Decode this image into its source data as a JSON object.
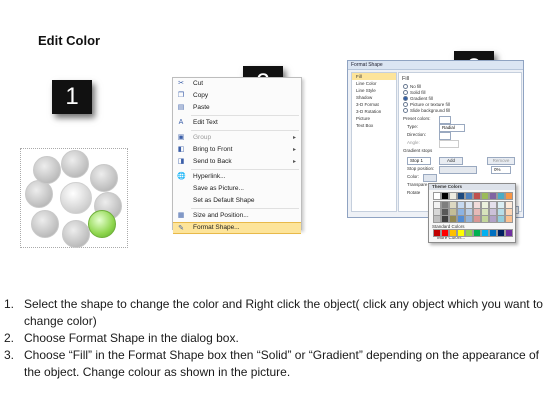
{
  "title": "Edit Color",
  "badges": [
    "1",
    "2",
    "3"
  ],
  "context_menu": {
    "items": [
      {
        "label": "Cut",
        "icon": "scissors-icon",
        "glyph": "✂",
        "disabled": false,
        "submenu": false
      },
      {
        "label": "Copy",
        "icon": "copy-icon",
        "glyph": "❐",
        "disabled": false,
        "submenu": false
      },
      {
        "label": "Paste",
        "icon": "paste-icon",
        "glyph": "▤",
        "disabled": false,
        "submenu": false
      },
      {
        "label": "Edit Text",
        "icon": "edit-text-icon",
        "glyph": "A",
        "disabled": false,
        "submenu": false
      },
      {
        "label": "Group",
        "icon": "group-icon",
        "glyph": "▣",
        "disabled": true,
        "submenu": true
      },
      {
        "label": "Bring to Front",
        "icon": "bring-front-icon",
        "glyph": "◧",
        "disabled": false,
        "submenu": true
      },
      {
        "label": "Send to Back",
        "icon": "send-back-icon",
        "glyph": "◨",
        "disabled": false,
        "submenu": true
      },
      {
        "label": "Hyperlink...",
        "icon": "hyperlink-icon",
        "glyph": "🌐",
        "disabled": false,
        "submenu": false
      },
      {
        "label": "Save as Picture...",
        "icon": "",
        "glyph": "",
        "disabled": false,
        "submenu": false
      },
      {
        "label": "Set as Default Shape",
        "icon": "",
        "glyph": "",
        "disabled": false,
        "submenu": false
      },
      {
        "label": "Size and Position...",
        "icon": "size-icon",
        "glyph": "▦",
        "disabled": false,
        "submenu": false
      },
      {
        "label": "Format Shape...",
        "icon": "format-shape-icon",
        "glyph": "✎",
        "disabled": false,
        "submenu": false,
        "highlight": true
      }
    ]
  },
  "dialog": {
    "title": "Format Shape",
    "nav": [
      "Fill",
      "Line Color",
      "Line Style",
      "Shadow",
      "3-D Format",
      "3-D Rotation",
      "Picture",
      "Text Box"
    ],
    "fill_heading": "Fill",
    "options": [
      "No fill",
      "Solid fill",
      "Gradient fill",
      "Picture or texture fill",
      "Slide background fill"
    ],
    "preset_label": "Preset colors:",
    "type_label": "Type:",
    "type_value": "Radial",
    "direction_label": "Direction:",
    "angle_label": "Angle:",
    "gradient_stops_label": "Gradient stops",
    "stop_value": "Stop 1",
    "add_label": "Add",
    "remove_label": "Remove",
    "stop_position_label": "Stop position:",
    "stop_position_value": "0%",
    "color_label": "Color:",
    "transparency_label": "Transpare",
    "rotate_label": "Rotate"
  },
  "palette": {
    "theme_label": "Theme Colors",
    "standard_label": "Standard Colors",
    "more_label": "More Colors...",
    "theme_rows": [
      [
        "#ffffff",
        "#000000",
        "#eeece1",
        "#1f497d",
        "#4f81bd",
        "#c0504d",
        "#9bbb59",
        "#8064a2",
        "#4bacc6",
        "#f79646"
      ],
      [
        "#f2f2f2",
        "#7f7f7f",
        "#ddd9c3",
        "#c6d9f0",
        "#dbe5f1",
        "#f2dcdb",
        "#ebf1dd",
        "#e5e0ec",
        "#dbeef3",
        "#fdeada"
      ],
      [
        "#d8d8d8",
        "#595959",
        "#c4bd97",
        "#8db3e2",
        "#b8cce4",
        "#e5b9b7",
        "#d7e3bc",
        "#ccc1d9",
        "#b7dde8",
        "#fbd5b5"
      ],
      [
        "#bfbfbf",
        "#3f3f3f",
        "#938953",
        "#548dd4",
        "#95b3d7",
        "#d99694",
        "#c3d69b",
        "#b2a2c7",
        "#92cddc",
        "#fac08f"
      ]
    ],
    "standard": [
      "#c00000",
      "#ff0000",
      "#ffc000",
      "#ffff00",
      "#92d050",
      "#00b050",
      "#00b0f0",
      "#0070c0",
      "#002060",
      "#7030a0"
    ]
  },
  "instructions": [
    {
      "num": "1.",
      "text": "Select the shape to change the color and Right click the object( click any object which you want to change color)"
    },
    {
      "num": "2.",
      "text": "Choose Format Shape in the dialog box."
    },
    {
      "num": "3.",
      "text": "Choose “Fill” in the Format Shape box then “Solid” or “Gradient” depending on the appearance of the object. Change colour as shown in the picture."
    }
  ]
}
